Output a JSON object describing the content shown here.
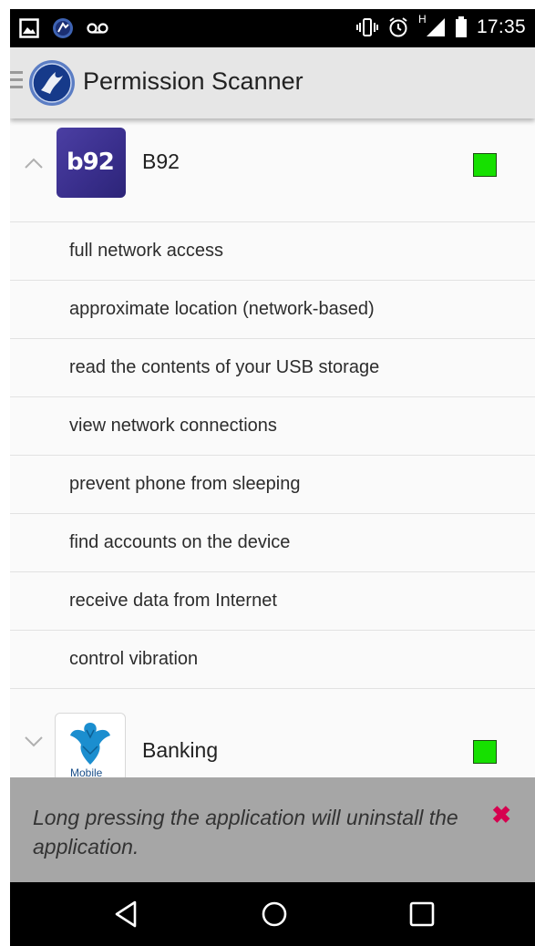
{
  "status_bar": {
    "time": "17:35",
    "network_label": "H"
  },
  "action_bar": {
    "title": "Permission Scanner"
  },
  "apps": [
    {
      "name": "B92",
      "icon_text": "b92",
      "expanded": true,
      "status_color": "#16e000",
      "permissions": [
        "full network access",
        "approximate location (network-based)",
        "read the contents of your USB storage",
        "view network connections",
        "prevent phone from sleeping",
        "find accounts on the device",
        "receive data from Internet",
        "control vibration"
      ]
    },
    {
      "name": "Banking",
      "icon_text": "Mobile",
      "expanded": false,
      "status_color": "#16e000"
    }
  ],
  "toast": {
    "message": "Long pressing the application will uninstall the application.",
    "close_symbol": "✖"
  },
  "colors": {
    "accent_close": "#d6004f",
    "toast_bg": "#a6a6a6"
  }
}
